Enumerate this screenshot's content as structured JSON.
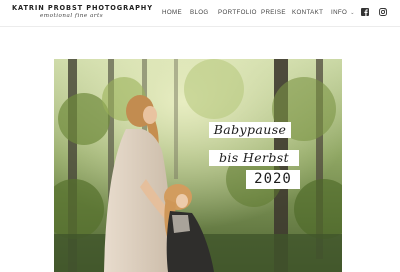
{
  "brand": {
    "title": "KATRIN PROBST PHOTOGRAPHY",
    "subtitle": "emotional fine arts"
  },
  "nav": {
    "items": [
      {
        "label": "HOME"
      },
      {
        "label": "BLOG"
      },
      {
        "label": "PORTFOLIO"
      },
      {
        "label": "PREISE"
      },
      {
        "label": "KONTAKT"
      },
      {
        "label": "INFO"
      }
    ],
    "info_caret": "⌄"
  },
  "social": {
    "icons": [
      "facebook-icon",
      "instagram-icon"
    ]
  },
  "hero": {
    "line1": "Babypause",
    "line2": "bis Herbst",
    "line3": "2020"
  },
  "colors": {
    "text": "#444444",
    "tag_background": "#ffffff"
  }
}
